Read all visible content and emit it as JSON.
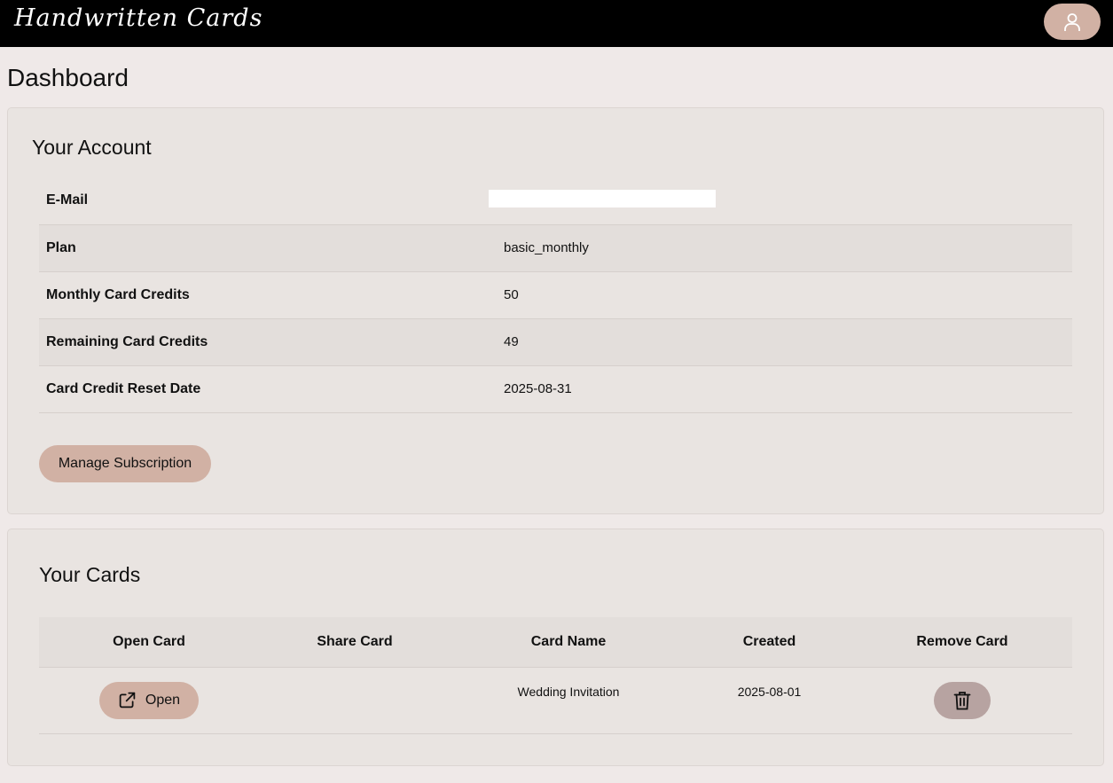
{
  "header": {
    "logo_text": "Handwritten Cards",
    "account_icon": "user-icon"
  },
  "page": {
    "title": "Dashboard"
  },
  "account": {
    "title": "Your Account",
    "rows": [
      {
        "label": "E-Mail",
        "value": ""
      },
      {
        "label": "Plan",
        "value": "basic_monthly"
      },
      {
        "label": "Monthly Card Credits",
        "value": "50"
      },
      {
        "label": "Remaining Card Credits",
        "value": "49"
      },
      {
        "label": "Card Credit Reset Date",
        "value": "2025-08-31"
      }
    ],
    "manage_label": "Manage Subscription"
  },
  "cards": {
    "title": "Your Cards",
    "columns": [
      "Open Card",
      "Share Card",
      "Card Name",
      "Created",
      "Remove Card"
    ],
    "rows": [
      {
        "open_label": "Open",
        "share": "",
        "name": "Wedding Invitation",
        "created": "2025-08-01"
      }
    ],
    "open_icon": "external-link-icon",
    "remove_icon": "trash-icon"
  },
  "colors": {
    "accent": "#d1b1a4",
    "remove_button": "#b7a3a1",
    "topbar": "#000000",
    "background": "#efe9e8"
  }
}
